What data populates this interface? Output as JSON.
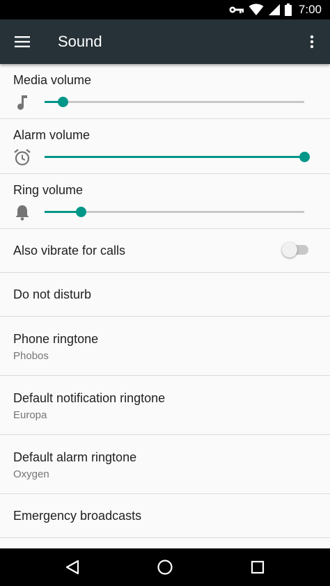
{
  "status_bar": {
    "time": "7:00",
    "icons": [
      "vpn-key-icon",
      "wifi-icon",
      "signal-icon",
      "battery-icon"
    ]
  },
  "app_bar": {
    "title": "Sound",
    "menu_icon": "hamburger-menu-icon",
    "overflow_icon": "more-vert-icon"
  },
  "settings": {
    "media_volume": {
      "label": "Media volume",
      "icon": "music-note-icon",
      "level": 0.07
    },
    "alarm_volume": {
      "label": "Alarm volume",
      "icon": "alarm-clock-icon",
      "level": 1.0
    },
    "ring_volume": {
      "label": "Ring volume",
      "icon": "bell-icon",
      "level": 0.14
    },
    "vibrate": {
      "label": "Also vibrate for calls",
      "on": false
    },
    "dnd": {
      "label": "Do not disturb"
    },
    "phone_ringtone": {
      "label": "Phone ringtone",
      "value": "Phobos"
    },
    "notification_ringtone": {
      "label": "Default notification ringtone",
      "value": "Europa"
    },
    "alarm_ringtone": {
      "label": "Default alarm ringtone",
      "value": "Oxygen"
    },
    "emergency": {
      "label": "Emergency broadcasts"
    }
  },
  "colors": {
    "accent": "#009688",
    "app_bar": "#263238",
    "track": "#c8c8c8"
  },
  "nav_bar": {
    "buttons": [
      "back-icon",
      "home-icon",
      "recents-icon"
    ]
  }
}
